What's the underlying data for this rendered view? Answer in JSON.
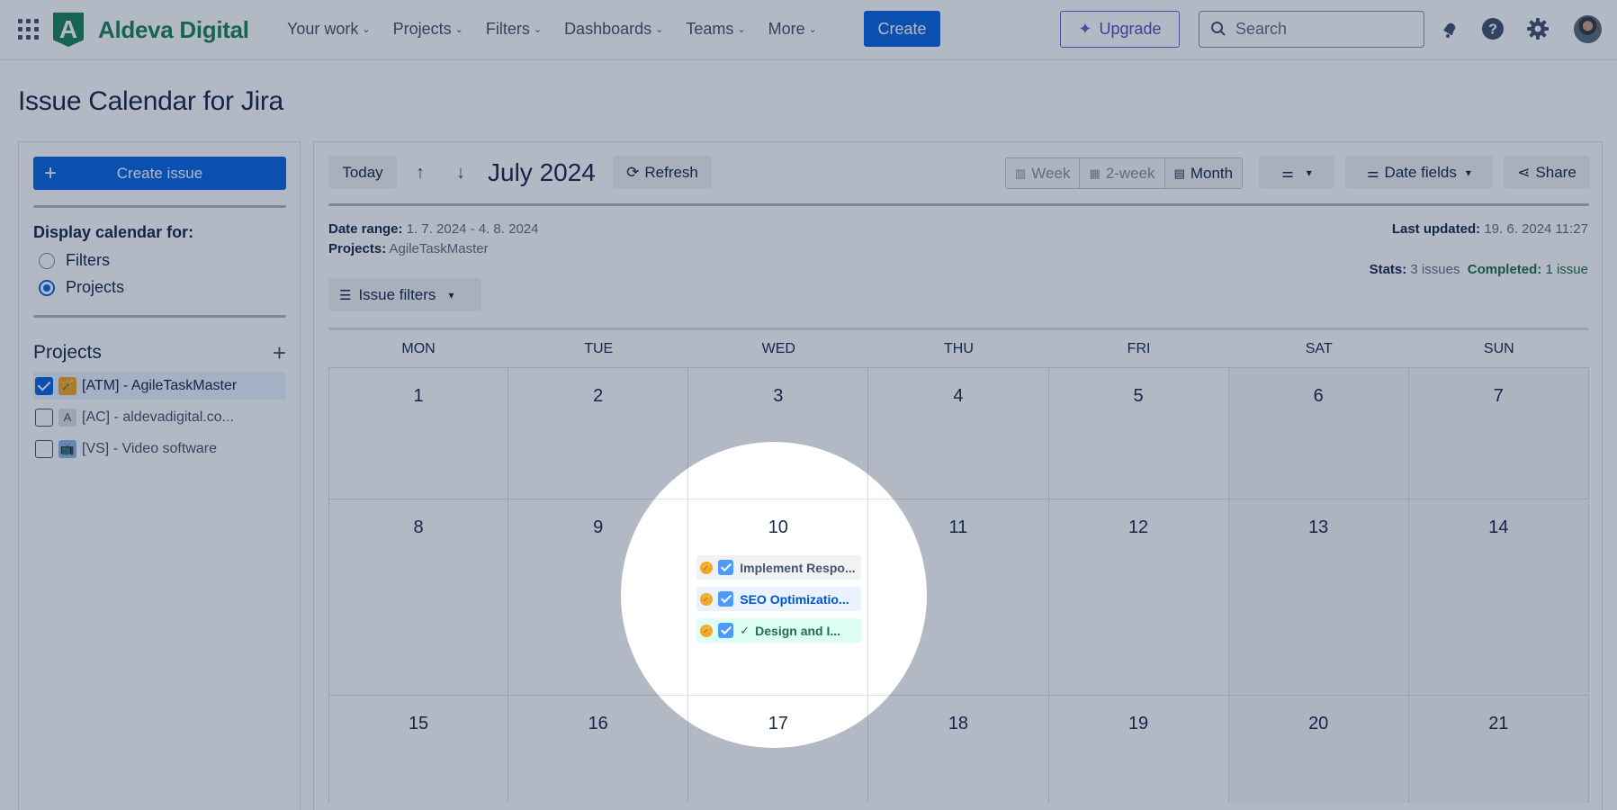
{
  "nav": {
    "brand": "Aldeva Digital",
    "brand_letter": "A",
    "menu": [
      {
        "label": "Your work"
      },
      {
        "label": "Projects"
      },
      {
        "label": "Filters"
      },
      {
        "label": "Dashboards"
      },
      {
        "label": "Teams"
      },
      {
        "label": "More"
      }
    ],
    "create_label": "Create",
    "upgrade_label": "Upgrade",
    "search_placeholder": "Search"
  },
  "page": {
    "title": "Issue Calendar for Jira"
  },
  "sidebar": {
    "create_issue_label": "Create issue",
    "display_label": "Display calendar for:",
    "options": [
      {
        "label": "Filters",
        "selected": false
      },
      {
        "label": "Projects",
        "selected": true
      }
    ],
    "projects_heading": "Projects",
    "projects": [
      {
        "label": "[ATM] - AgileTaskMaster",
        "checked": true,
        "icon": "🪄"
      },
      {
        "label": "[AC] - aldevadigital.co...",
        "checked": false,
        "icon": "A"
      },
      {
        "label": "[VS] - Video software",
        "checked": false,
        "icon": "📺"
      }
    ]
  },
  "toolbar": {
    "today_label": "Today",
    "month_title": "July 2024",
    "refresh_label": "Refresh",
    "views": [
      "Week",
      "2-week",
      "Month"
    ],
    "active_view": "Month",
    "date_fields_label": "Date fields",
    "share_label": "Share"
  },
  "meta": {
    "date_range_label": "Date range:",
    "date_range_value": "1. 7. 2024 - 4. 8. 2024",
    "projects_label": "Projects:",
    "projects_value": "AgileTaskMaster",
    "last_updated_label": "Last updated:",
    "last_updated_value": "19. 6. 2024 11:27",
    "stats_label": "Stats:",
    "stats_value": "3 issues",
    "completed_label": "Completed:",
    "completed_value": "1 issue"
  },
  "issue_filters_label": "Issue filters",
  "calendar": {
    "weekdays": [
      "MON",
      "TUE",
      "WED",
      "THU",
      "FRI",
      "SAT",
      "SUN"
    ],
    "weeks": [
      [
        "1",
        "2",
        "3",
        "4",
        "5",
        "6",
        "7"
      ],
      [
        "8",
        "9",
        "10",
        "11",
        "12",
        "13",
        "14"
      ],
      [
        "15",
        "16",
        "17",
        "18",
        "19",
        "20",
        "21"
      ]
    ],
    "events": [
      {
        "title": "Implement Respo...",
        "style": "grey",
        "done": false
      },
      {
        "title": "SEO Optimizatio...",
        "style": "blue",
        "done": false
      },
      {
        "title": "Design and I...",
        "style": "green",
        "done": true
      }
    ]
  },
  "colors": {
    "accent": "#0c66e4",
    "brand": "#1f845a",
    "upgrade": "#6e5dc6",
    "completed": "#216e4e"
  }
}
